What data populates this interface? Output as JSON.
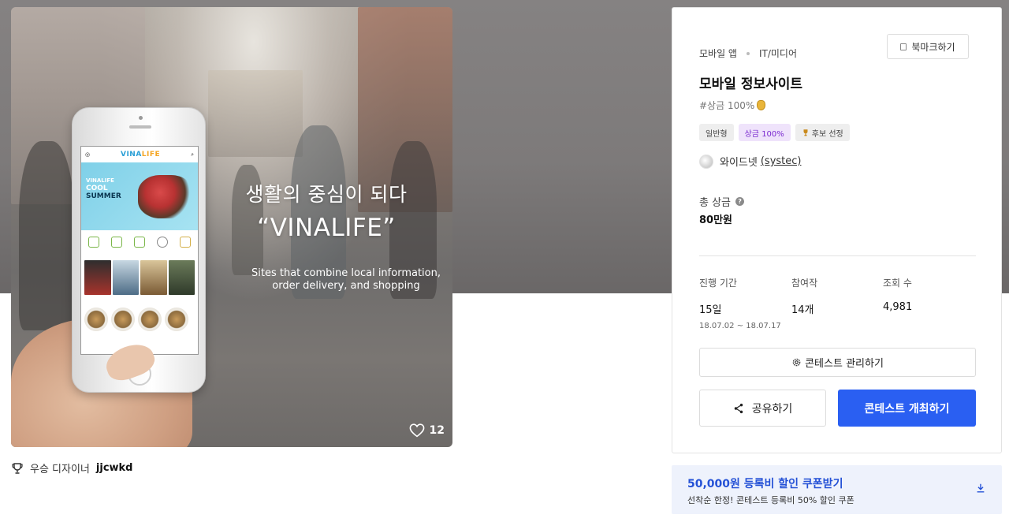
{
  "hero": {
    "title": "생활의 중심이 되다",
    "brand": "“VINALIFE”",
    "caption": "Sites that combine local information, order delivery, and shopping",
    "likes": "12",
    "app": {
      "logo_main": "VINA",
      "logo_accent": "LIFE",
      "banner_line1": "VINALIFE",
      "banner_line2": "COOL",
      "banner_line3": "SUMMER"
    }
  },
  "winner": {
    "label": "우승 디자이너",
    "name": "jjcwkd"
  },
  "contest": {
    "categories": [
      "모바일 앱",
      "IT/미디어"
    ],
    "bookmark_label": "북마크하기",
    "title": "모바일 정보사이트",
    "hashtag": "#상금 100%",
    "tags": [
      "일반형",
      "상금 100%",
      "후보 선정"
    ],
    "host_name": "와이드넷",
    "host_id": "(systec)",
    "prize_label": "총 상금",
    "prize_value": "80만원",
    "stats": {
      "period_label": "진행 기간",
      "period_value": "15일",
      "period_range": "18.07.02 ~ 18.07.17",
      "entries_label": "참여작",
      "entries_value": "14개",
      "views_label": "조회 수",
      "views_value": "4,981"
    },
    "manage_label": "콘테스트 관리하기",
    "share_label": "공유하기",
    "host_label": "콘테스트 개최하기"
  },
  "coupon": {
    "title": "50,000원 등록비 할인 쿠폰받기",
    "subtitle": "선착순 한정! 콘테스트 등록비 50% 할인 쿠폰"
  },
  "colors": {
    "primary_button": "#2a5ff2",
    "coupon_title": "#2451d6",
    "coupon_bg": "#eef2fc",
    "purple_tag_bg": "#efe3fb",
    "purple_tag_text": "#7b2bd0"
  },
  "icons": [
    "heart-icon",
    "trophy-icon",
    "bookmark-icon",
    "moneybag-icon",
    "help-icon",
    "gear-icon",
    "share-icon",
    "download-icon"
  ]
}
